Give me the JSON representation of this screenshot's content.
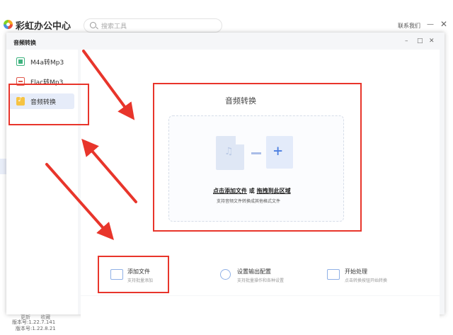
{
  "app": {
    "title": "彩虹办公中心"
  },
  "search": {
    "placeholder": "搜索工具"
  },
  "header": {
    "contact": "联系我们",
    "minimize": "—",
    "close": "✕"
  },
  "dialog": {
    "title": "音频转换",
    "controls": {
      "minimize": "–",
      "maximize": "□",
      "close": "✕"
    }
  },
  "sidebar": {
    "items": [
      {
        "label": "M4a转Mp3",
        "icon": "m4a-file-icon"
      },
      {
        "label": "Flac转Mp3",
        "icon": "flac-file-icon"
      },
      {
        "label": "音频转换",
        "icon": "audio-icon",
        "active": true
      }
    ],
    "version": "版本号:1.22.7.141"
  },
  "panel": {
    "title": "音频转换",
    "add_link": "点击添加文件",
    "or": " 或 ",
    "drag_link": "拖拽到此区域",
    "sub": "支持音频文件转换成其他格式文件"
  },
  "actions": [
    {
      "title": "添加文件",
      "sub": "支持批量添加",
      "icon": "folder-add-icon"
    },
    {
      "title": "设置输出配置",
      "sub": "支持批量操作和各种设置",
      "icon": "settings-icon"
    },
    {
      "title": "开始处理",
      "sub": "点击转换按钮开始转换",
      "icon": "convert-icon"
    }
  ],
  "background": {
    "footer_links": [
      "更新",
      "收藏"
    ],
    "version": "版本号:1.22.8.21"
  },
  "colors": {
    "accent": "#4a7ee0",
    "annotation": "#e8352b"
  }
}
